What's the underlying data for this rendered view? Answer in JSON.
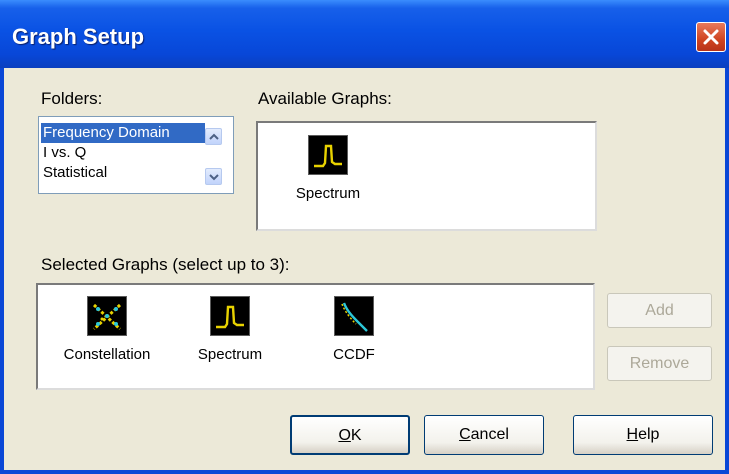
{
  "window": {
    "title": "Graph Setup"
  },
  "folders": {
    "label": "Folders:",
    "items": [
      "Frequency Domain",
      "I vs. Q",
      "Statistical"
    ],
    "selected_index": 0
  },
  "available": {
    "label": "Available Graphs:",
    "graphs": [
      {
        "label": "Spectrum",
        "icon": "spectrum-graph-icon"
      }
    ]
  },
  "selected": {
    "label": "Selected Graphs (select up to 3):",
    "graphs": [
      {
        "label": "Constellation",
        "icon": "constellation-graph-icon"
      },
      {
        "label": "Spectrum",
        "icon": "spectrum-graph-icon"
      },
      {
        "label": "CCDF",
        "icon": "ccdf-graph-icon"
      }
    ]
  },
  "buttons": {
    "add": "Add",
    "remove": "Remove",
    "ok_first": "O",
    "ok_rest": "K",
    "cancel_first": "C",
    "cancel_rest": "ancel",
    "help_first": "H",
    "help_rest": "elp"
  },
  "colors": {
    "titlebar": "#0a52e4",
    "face": "#ece9d8",
    "selection": "#316ac5",
    "icon_yellow": "#e8d200",
    "icon_cyan": "#2cc7d8"
  }
}
